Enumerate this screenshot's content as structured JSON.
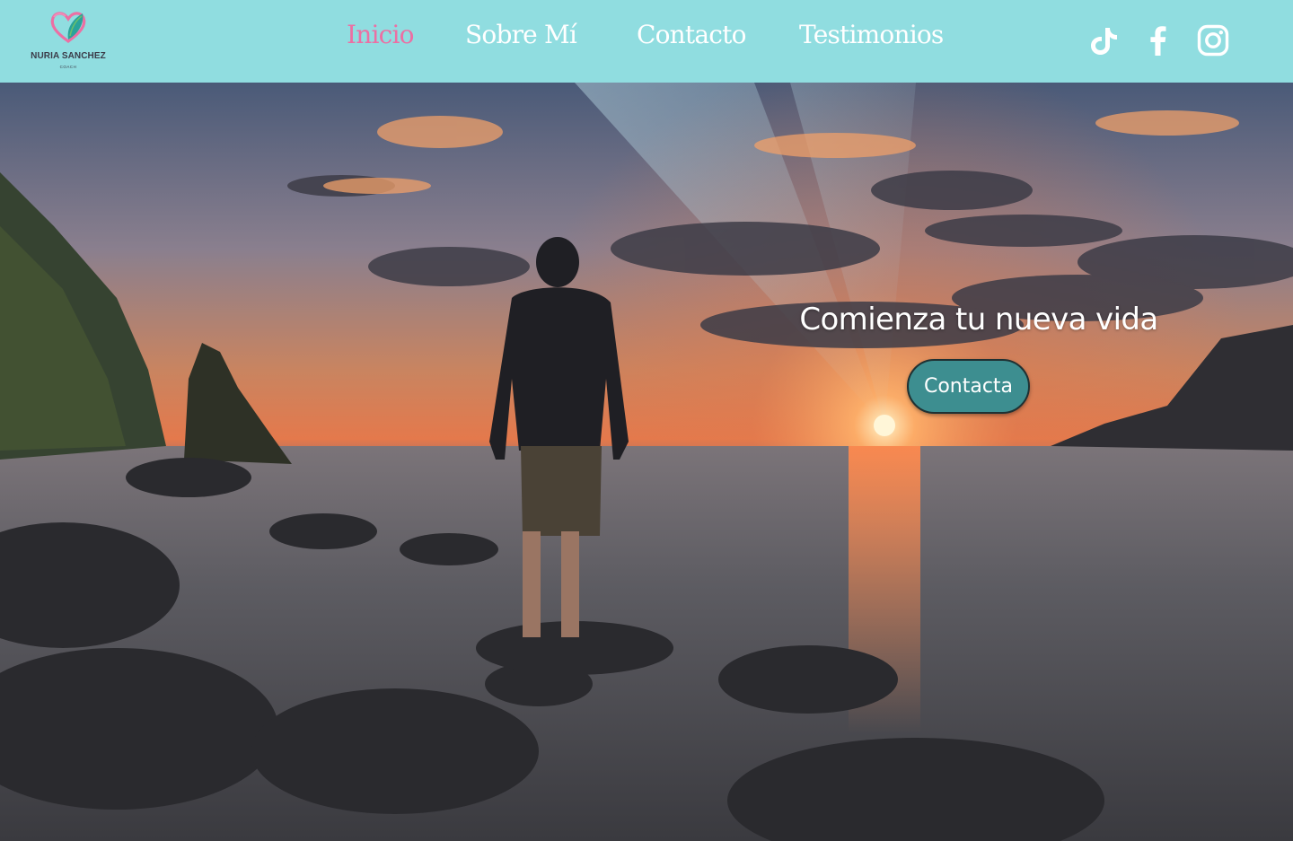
{
  "brand": {
    "name": "NURIA SANCHEZ",
    "tagline": "COACH",
    "logo_icon": "heart-leaf-logo",
    "colors": {
      "pink": "#ec6fa3",
      "teal": "#2aa39a",
      "green": "#6bbf6a"
    }
  },
  "nav": {
    "items": [
      {
        "label": "Inicio",
        "active": true
      },
      {
        "label": "Sobre Mí",
        "active": false
      },
      {
        "label": "Contacto",
        "active": false
      },
      {
        "label": "Testimonios",
        "active": false
      }
    ]
  },
  "social": [
    {
      "icon": "tiktok-icon"
    },
    {
      "icon": "facebook-icon"
    },
    {
      "icon": "instagram-icon"
    }
  ],
  "hero": {
    "title": "Comienza tu nueva vida",
    "cta_label": "Contacta"
  },
  "colors": {
    "header_bg": "#90dde0",
    "nav_text": "#ffffff",
    "nav_active": "#ec6fa3",
    "cta_bg": "#3d8e90"
  }
}
